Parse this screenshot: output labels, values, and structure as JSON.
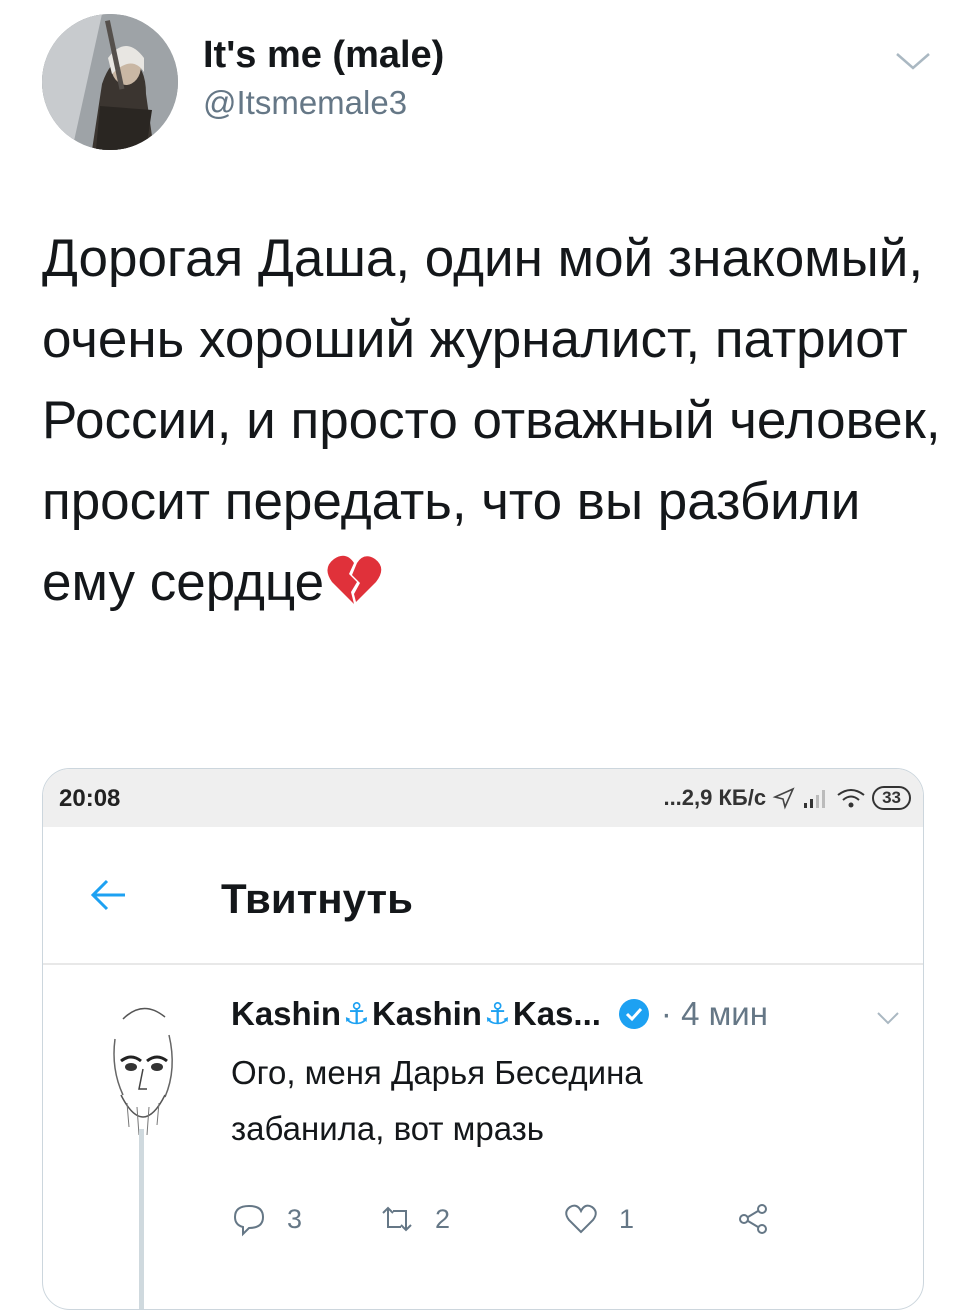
{
  "tweet": {
    "author_name": "It's me (male)",
    "author_handle": "@Itsmemale3",
    "text": "Дорогая Даша, один мой знакомый, очень хороший журналист, патриот России, и просто отважный человек, просит передать, что вы разбили ему сердце",
    "emoji_icon": "broken-heart-icon"
  },
  "embedded_screenshot": {
    "status_bar": {
      "time": "20:08",
      "network": "...2,9 КБ/с",
      "battery": "33"
    },
    "app_bar": {
      "title": "Твитнуть"
    },
    "inner_tweet": {
      "name": "Kashin",
      "name_2": "Kashin",
      "name_3": "Kas...",
      "anchor": "⚓",
      "time": "· 4 мин",
      "text_line1": "Ого, меня Дарья Беседина",
      "text_line2": "забанила, вот мразь",
      "reply_count": "3",
      "retweet_count": "2",
      "like_count": "1"
    }
  },
  "colors": {
    "accent": "#1da1f2",
    "secondary_text": "#657786",
    "broken_heart": "#e0313a"
  }
}
